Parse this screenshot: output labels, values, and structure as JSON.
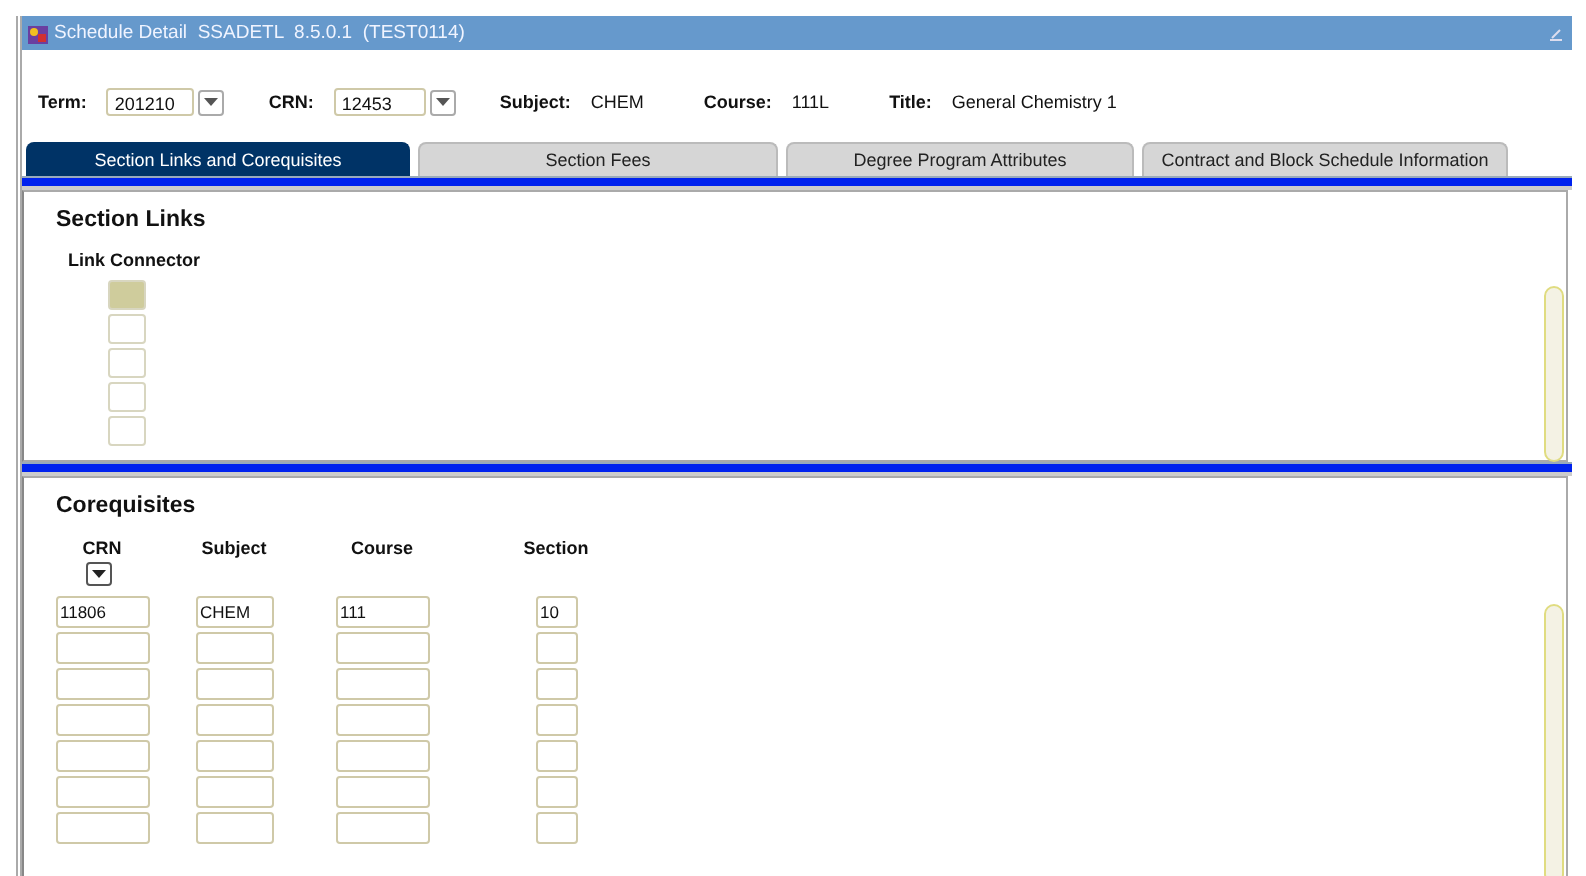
{
  "window": {
    "title": "Schedule Detail  SSADETL  8.5.0.1  (TEST0114)"
  },
  "key_block": {
    "term_label": "Term:",
    "term": "201210",
    "crn_label": "CRN:",
    "crn": "12453",
    "subject_label": "Subject:",
    "subject": "CHEM",
    "course_label": "Course:",
    "course": "111L",
    "title_label": "Title:",
    "title": "General Chemistry 1"
  },
  "tabs": [
    {
      "label": "Section Links and Corequisites",
      "selected": true
    },
    {
      "label": "Section Fees",
      "selected": false
    },
    {
      "label": "Degree Program Attributes",
      "selected": false
    },
    {
      "label": "Contract and Block Schedule Information",
      "selected": false
    }
  ],
  "section_links": {
    "heading": "Section Links",
    "column": "Link Connector",
    "rows": [
      {
        "selected": true
      },
      {
        "selected": false
      },
      {
        "selected": false
      },
      {
        "selected": false
      },
      {
        "selected": false
      }
    ]
  },
  "corequisites": {
    "heading": "Corequisites",
    "columns": [
      "CRN",
      "Subject",
      "Course",
      "Section"
    ],
    "rows": [
      {
        "kind": "filled",
        "crn": "11806",
        "subject": "CHEM",
        "course": "111",
        "section": "10"
      },
      {
        "kind": "empty"
      },
      {
        "kind": "empty"
      },
      {
        "kind": "empty"
      },
      {
        "kind": "empty"
      },
      {
        "kind": "empty"
      },
      {
        "kind": "empty"
      }
    ]
  }
}
